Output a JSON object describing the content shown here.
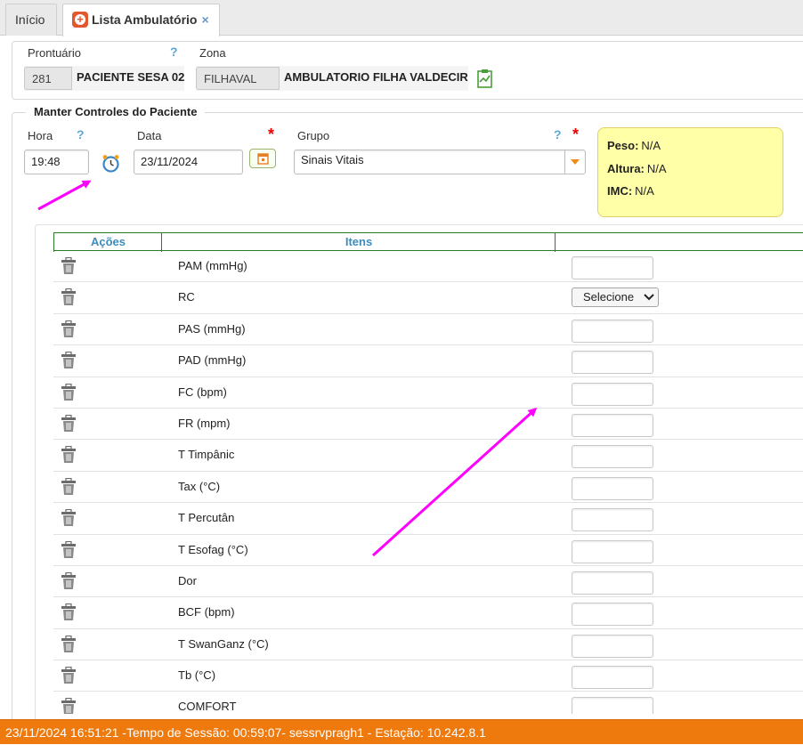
{
  "tabs": [
    {
      "label": "Início",
      "active": false
    },
    {
      "label": "Lista Ambulatório",
      "active": true,
      "close": "×"
    }
  ],
  "patient": {
    "prontuario_label": "Prontuário",
    "prontuario_help": "?",
    "prontuario_id": "281",
    "patient_name": "PACIENTE SESA 02",
    "zona_label": "Zona",
    "zona_code": "FILHAVAL",
    "zona_name": "AMBULATORIO FILHA VALDECIR"
  },
  "controls": {
    "legend": "Manter Controles do Paciente",
    "hora_label": "Hora",
    "hora_help": "?",
    "hora_value": "19:48",
    "data_label": "Data",
    "data_required": "*",
    "data_value": "23/11/2024",
    "grupo_label": "Grupo",
    "grupo_help": "?",
    "grupo_required": "*",
    "grupo_value": "Sinais Vitais"
  },
  "info": {
    "peso_label": "Peso:",
    "peso_value": "N/A",
    "altura_label": "Altura:",
    "altura_value": "N/A",
    "imc_label": "IMC:",
    "imc_value": "N/A"
  },
  "table": {
    "headers": {
      "acoes": "Ações",
      "itens": "Itens",
      "valor": ""
    },
    "rows": [
      {
        "item": "PAM (mmHg)",
        "input": "text"
      },
      {
        "item": "RC",
        "input": "select",
        "select_value": "Selecione"
      },
      {
        "item": "PAS (mmHg)",
        "input": "text"
      },
      {
        "item": "PAD (mmHg)",
        "input": "text"
      },
      {
        "item": "FC (bpm)",
        "input": "text"
      },
      {
        "item": "FR (mpm)",
        "input": "text"
      },
      {
        "item": "T Timpânic",
        "input": "text"
      },
      {
        "item": "Tax (°C)",
        "input": "text"
      },
      {
        "item": "T Percutân",
        "input": "text"
      },
      {
        "item": "T Esofag (°C)",
        "input": "text"
      },
      {
        "item": "Dor",
        "input": "text"
      },
      {
        "item": "BCF (bpm)",
        "input": "text"
      },
      {
        "item": "T SwanGanz (°C)",
        "input": "text"
      },
      {
        "item": "Tb (°C)",
        "input": "text"
      },
      {
        "item": "COMFORT",
        "input": "text"
      }
    ]
  },
  "status": {
    "text": "23/11/2024 16:51:21 -Tempo de Sessão: 00:59:07- sessrvpragh1 - Estação: 10.242.8.1"
  },
  "colors": {
    "status_bar": "#ee7a0e",
    "header_text": "#3c8dbc",
    "info_box": "#ffffa8",
    "annotation_arrow": "#ff00ff",
    "required": "#e00000"
  },
  "icons": {
    "tab_icon": "medical-cross-icon",
    "zona_icon": "chart-document-icon",
    "clock_icon": "alarm-clock-icon",
    "calendar_icon": "calendar-icon",
    "row_action_icon": "trash-icon"
  }
}
